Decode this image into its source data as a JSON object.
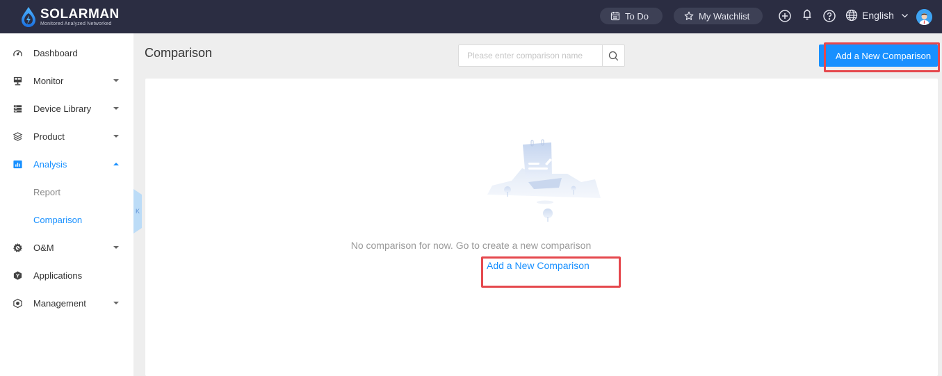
{
  "brand": {
    "name": "SOLARMAN",
    "tagline": "Monitored Analyzed Networked",
    "accent": "#1890ff",
    "topbar_bg": "#2b2d42"
  },
  "topbar": {
    "todo_label": "To Do",
    "watchlist_label": "My Watchlist",
    "language": "English",
    "icons": [
      "calendar-icon",
      "star-icon",
      "plus-circle-icon",
      "bell-icon",
      "help-icon",
      "globe-icon",
      "chevron-down-icon",
      "avatar"
    ]
  },
  "sidebar": {
    "items": [
      {
        "label": "Dashboard",
        "icon": "dashboard-icon",
        "caret": null
      },
      {
        "label": "Monitor",
        "icon": "monitor-icon",
        "caret": "down"
      },
      {
        "label": "Device Library",
        "icon": "device-library-icon",
        "caret": "down"
      },
      {
        "label": "Product",
        "icon": "layers-icon",
        "caret": "down"
      },
      {
        "label": "Analysis",
        "icon": "bar-chart-icon",
        "caret": "up",
        "active": true,
        "children": [
          {
            "label": "Report"
          },
          {
            "label": "Comparison",
            "active": true
          }
        ]
      },
      {
        "label": "O&M",
        "icon": "gear-wrench-icon",
        "caret": "down"
      },
      {
        "label": "Applications",
        "icon": "applications-icon",
        "caret": null
      },
      {
        "label": "Management",
        "icon": "management-icon",
        "caret": "down"
      }
    ],
    "collapse_glyph": "K"
  },
  "main": {
    "title": "Comparison",
    "search": {
      "placeholder": "Please enter comparison name",
      "value": ""
    },
    "add_button": "Add a New Comparison",
    "empty_state": {
      "message": "No comparison for now. Go to create a new comparison",
      "link": "Add a New Comparison"
    }
  }
}
